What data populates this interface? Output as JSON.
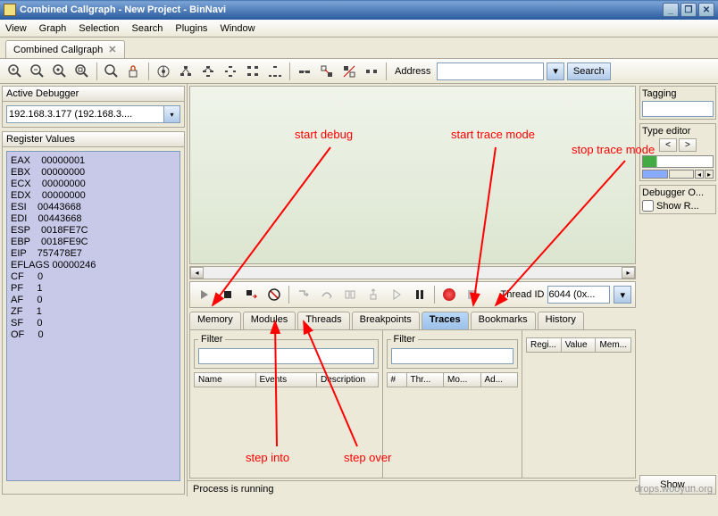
{
  "window": {
    "title": "Combined Callgraph - New Project - BinNavi",
    "min": "_",
    "max": "❐",
    "close": "✕"
  },
  "menu": [
    "View",
    "Graph",
    "Selection",
    "Search",
    "Plugins",
    "Window"
  ],
  "document_tab": {
    "label": "Combined Callgraph",
    "close": "✕"
  },
  "toolbar": {
    "address_label": "Address",
    "search_label": "Search"
  },
  "left": {
    "debugger_title": "Active Debugger",
    "debugger_value": "192.168.3.177 (192.168.3....",
    "registers_title": "Register Values",
    "registers": [
      {
        "name": "EAX",
        "value": "00000001"
      },
      {
        "name": "EBX",
        "value": "00000000"
      },
      {
        "name": "ECX",
        "value": "00000000"
      },
      {
        "name": "EDX",
        "value": "00000000"
      },
      {
        "name": "ESI",
        "value": "00443668"
      },
      {
        "name": "EDI",
        "value": "00443668"
      },
      {
        "name": "ESP",
        "value": "0018FE7C"
      },
      {
        "name": "EBP",
        "value": "0018FE9C"
      },
      {
        "name": "EIP",
        "value": "757478E7"
      },
      {
        "name": "EFLAGS",
        "value": "00000246"
      },
      {
        "name": "CF",
        "value": "0"
      },
      {
        "name": "PF",
        "value": "1"
      },
      {
        "name": "AF",
        "value": "0"
      },
      {
        "name": "ZF",
        "value": "1"
      },
      {
        "name": "SF",
        "value": "0"
      },
      {
        "name": "OF",
        "value": "0"
      }
    ]
  },
  "debugbar": {
    "thread_id_label": "Thread ID",
    "thread_id_value": "6044 (0x..."
  },
  "dbgtabs": [
    "Memory",
    "Modules",
    "Threads",
    "Breakpoints",
    "Traces",
    "Bookmarks",
    "History"
  ],
  "tracepanel": {
    "filter": "Filter",
    "cols_left": [
      "Name",
      "Events",
      "Description"
    ],
    "cols_mid": [
      "#",
      "Thr...",
      "Mo...",
      "Ad..."
    ],
    "cols_right": [
      "Regi...",
      "Value",
      "Mem..."
    ]
  },
  "right": {
    "tagging": "Tagging",
    "typeeditor": "Type editor",
    "back": "<",
    "fwd": ">",
    "debugger_o": "Debugger O...",
    "show_r": "Show R...",
    "show": "Show ..."
  },
  "status": "Process is running",
  "annotations": {
    "start_debug": "start debug",
    "step_into": "step into",
    "step_over": "step over",
    "start_trace": "start trace mode",
    "stop_trace": "stop trace mode"
  },
  "watermark": "drops.wooyun.org"
}
